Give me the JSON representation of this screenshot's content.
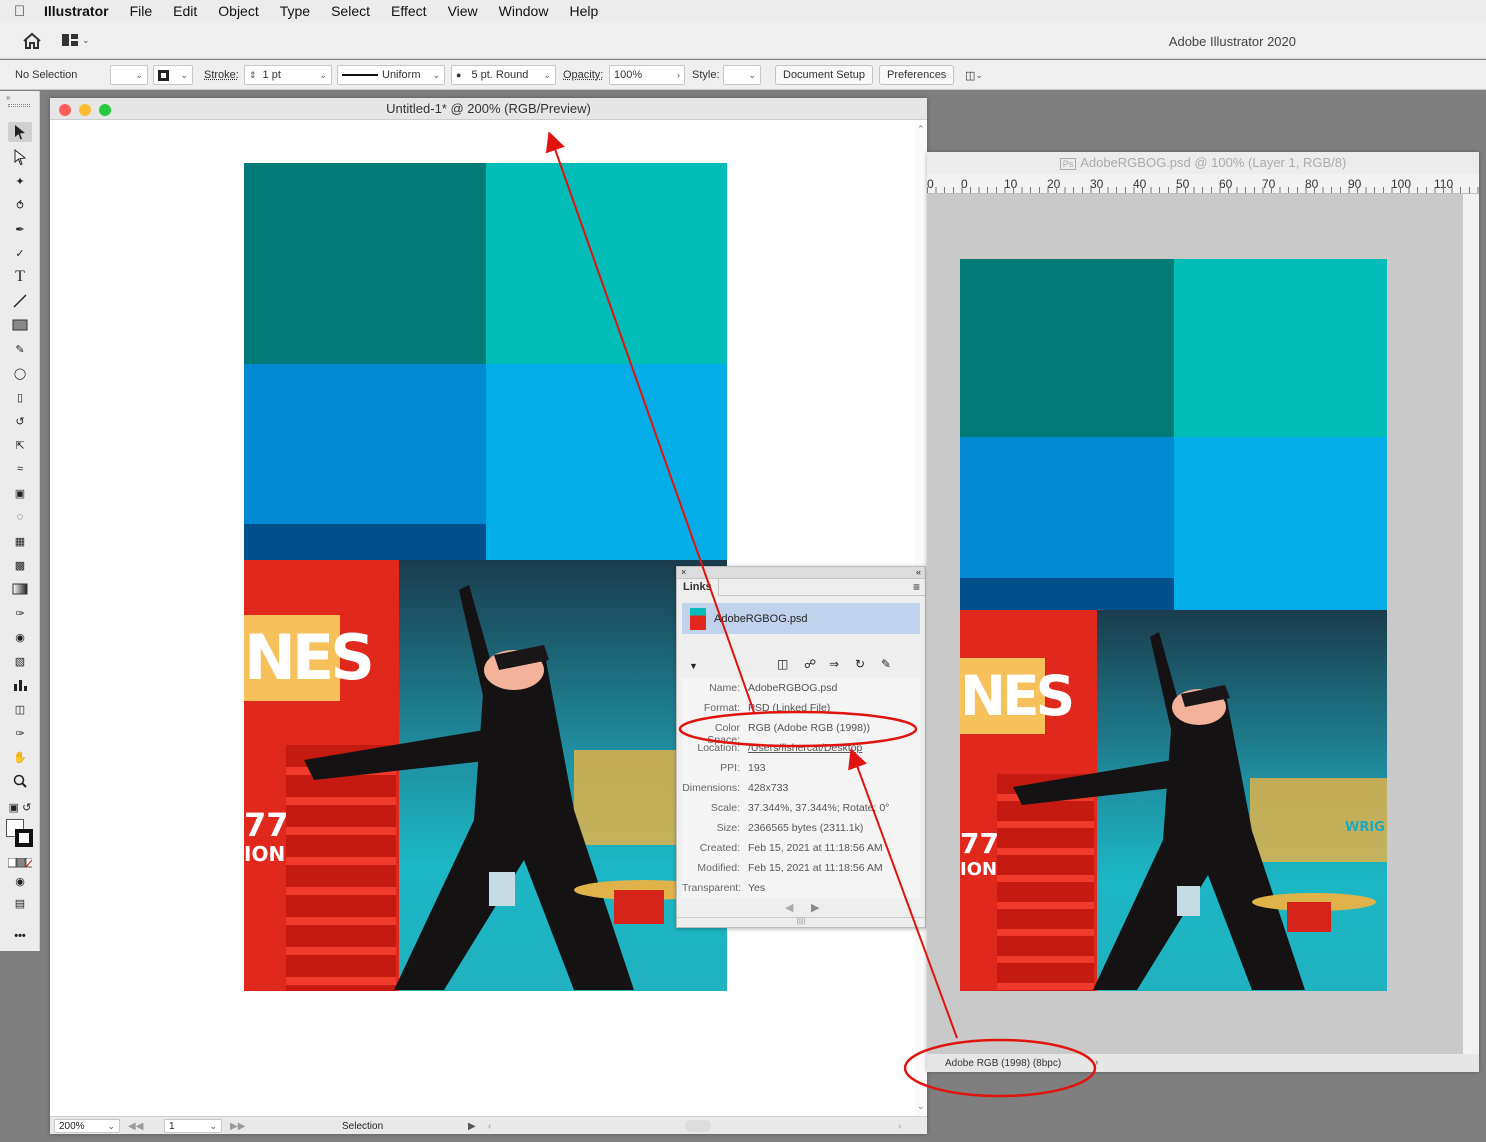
{
  "menubar": {
    "app": "Illustrator",
    "items": [
      "File",
      "Edit",
      "Object",
      "Type",
      "Select",
      "Effect",
      "View",
      "Window",
      "Help"
    ]
  },
  "appbar": {
    "title": "Adobe Illustrator 2020"
  },
  "control": {
    "selection": "No Selection",
    "stroke_label": "Stroke:",
    "stroke_value": "1 pt",
    "profile": "Uniform",
    "brush": "5 pt. Round",
    "opacity_label": "Opacity:",
    "opacity_value": "100%",
    "style_label": "Style:",
    "doc_setup": "Document Setup",
    "preferences": "Preferences"
  },
  "ai_doc": {
    "title": "Untitled-1* @ 200% (RGB/Preview)",
    "zoom": "200%",
    "artboard": "1",
    "status": "Selection"
  },
  "links_panel": {
    "tab": "Links",
    "file": "AdobeRGBOG.psd",
    "info": [
      {
        "k": "Name:",
        "v": "AdobeRGBOG.psd"
      },
      {
        "k": "Format:",
        "v": "PSD (Linked File)"
      },
      {
        "k": "Color Space:",
        "v": "RGB (Adobe RGB (1998))"
      },
      {
        "k": "Location:",
        "v": "/Users/fishercat/Desktop"
      },
      {
        "k": "PPI:",
        "v": "193"
      },
      {
        "k": "Dimensions:",
        "v": "428x733"
      },
      {
        "k": "Scale:",
        "v": "37.344%, 37.344%; Rotate: 0°"
      },
      {
        "k": "Size:",
        "v": "2366565 bytes (2311.1k)"
      },
      {
        "k": "Created:",
        "v": "Feb 15, 2021 at 11:18:56 AM"
      },
      {
        "k": "Modified:",
        "v": "Feb 15, 2021 at 11:18:56 AM"
      },
      {
        "k": "Transparent:",
        "v": "Yes"
      }
    ]
  },
  "ps_doc": {
    "title": "AdobeRGBOG.psd @ 100% (Layer 1, RGB/8)",
    "ruler": [
      "0",
      "0",
      "10",
      "20",
      "30",
      "40",
      "50",
      "60",
      "70",
      "80",
      "90",
      "100",
      "110"
    ],
    "status": "Adobe RGB (1998) (8bpc)"
  },
  "artwork_text": {
    "sign": "NES",
    "num": "77",
    "ion": "ION",
    "wrig": "WRIG"
  },
  "colors": {
    "teal_dark": "#017a78",
    "teal_light": "#02bcb8",
    "blue_mid": "#0289d4",
    "blue_light": "#03aee8",
    "navy": "#02508c",
    "annotation_red": "#e0130f"
  }
}
